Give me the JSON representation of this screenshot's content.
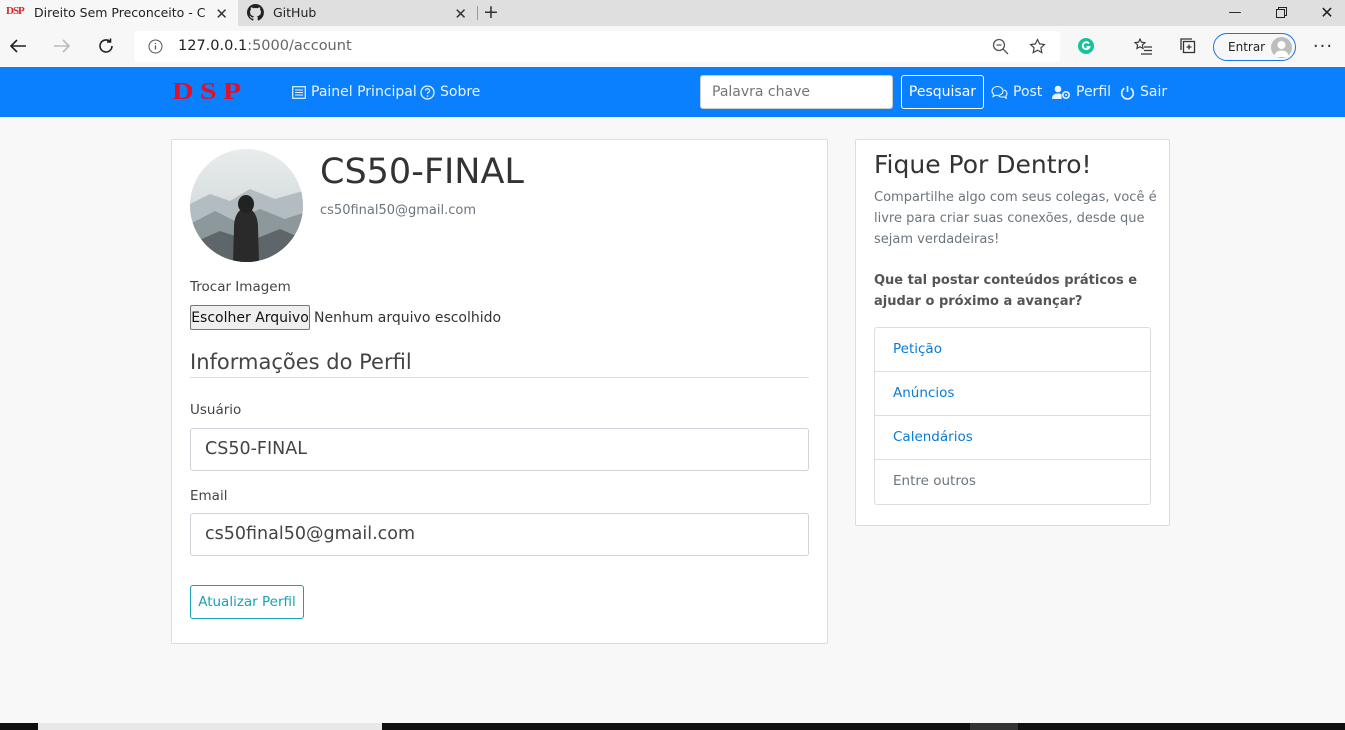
{
  "browser": {
    "tabs": [
      {
        "title": "Direito Sem Preconceito - Conta",
        "favicon": "DSP"
      },
      {
        "title": "GitHub"
      }
    ],
    "url": {
      "host": "127.0.0.1",
      "path": ":5000/account"
    },
    "signin_label": "Entrar"
  },
  "navbar": {
    "brand": "DSP",
    "links": {
      "dashboard": "Painel Principal",
      "about": "Sobre",
      "post": "Post",
      "profile": "Perfil",
      "logout": "Sair"
    },
    "search_placeholder": "Palavra chave",
    "search_button": "Pesquisar",
    "color": "#0a80ff"
  },
  "profile": {
    "username": "CS50-FINAL",
    "email": "cs50final50@gmail.com",
    "change_image_label": "Trocar Imagem",
    "file_button": "Escolher Arquivo",
    "file_status": "Nenhum arquivo escolhido",
    "section_title": "Informações do Perfil",
    "username_label": "Usuário",
    "username_value": "CS50-FINAL",
    "email_label": "Email",
    "email_value": "cs50final50@gmail.com",
    "submit": "Atualizar Perfil"
  },
  "sidebar": {
    "title": "Fique Por Dentro!",
    "text": "Compartilhe algo com seus colegas, você é livre para criar suas conexões, desde que sejam verdadeiras!",
    "question": "Que tal postar conteúdos práticos e ajudar o próximo a avançar?",
    "items": [
      "Petição",
      "Anúncios",
      "Calendários",
      "Entre outros"
    ]
  }
}
